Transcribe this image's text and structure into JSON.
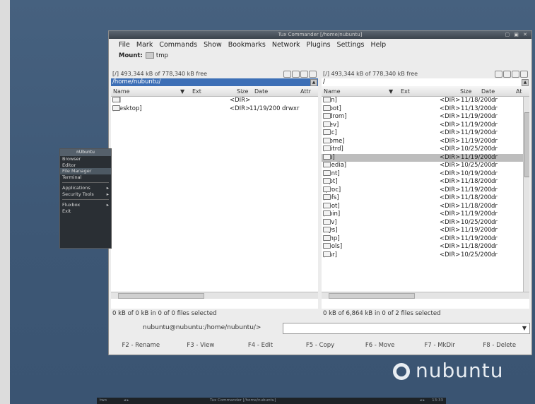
{
  "window": {
    "title": "Tux Commander [/home/nubuntu]",
    "title_buttons": "▢ ▣ ✕"
  },
  "menu": [
    "File",
    "Mark",
    "Commands",
    "Show",
    "Bookmarks",
    "Network",
    "Plugins",
    "Settings",
    "Help"
  ],
  "mount": {
    "label": "Mount:",
    "drive": "tmp"
  },
  "left": {
    "free": "[/] 493,344 kB of 778,340 kB free",
    "path": "/home/nubuntu/",
    "hist": "▲",
    "cols": {
      "name": "Name",
      "ext": "Ext",
      "size": "Size",
      "date": "Date",
      "attr": "Attr"
    },
    "sort_arrow": "▼",
    "rows": [
      {
        "name": "[..]",
        "size": "<DIR>",
        "date": "",
        "attr": "",
        "up": true
      },
      {
        "name": "[Desktop]",
        "size": "<DIR>",
        "date": "11/19/200",
        "attr": "drwxr"
      }
    ],
    "status": "0 kB of 0 kB in 0 of 0 files selected"
  },
  "right": {
    "free": "[/] 493,344 kB of 778,340 kB free",
    "path": "/",
    "hist": "▲",
    "cols": {
      "name": "Name",
      "ext": "Ext",
      "size": "Size",
      "date": "Date",
      "attr": "At"
    },
    "sort_arrow": "▼",
    "rows": [
      {
        "name": "[bin]",
        "size": "<DIR>",
        "date": "11/18/200",
        "attr": "dr"
      },
      {
        "name": "[boot]",
        "size": "<DIR>",
        "date": "11/13/200",
        "attr": "dr"
      },
      {
        "name": "[cdrom]",
        "size": "<DIR>",
        "date": "11/19/200",
        "attr": "dr"
      },
      {
        "name": "[dev]",
        "size": "<DIR>",
        "date": "11/19/200",
        "attr": "dr"
      },
      {
        "name": "[etc]",
        "size": "<DIR>",
        "date": "11/19/200",
        "attr": "dr"
      },
      {
        "name": "[home]",
        "size": "<DIR>",
        "date": "11/19/200",
        "attr": "dr"
      },
      {
        "name": "[initrd]",
        "size": "<DIR>",
        "date": "10/25/200",
        "attr": "dr"
      },
      {
        "name": "[lib]",
        "size": "<DIR>",
        "date": "11/19/200",
        "attr": "dr",
        "sel": true
      },
      {
        "name": "[media]",
        "size": "<DIR>",
        "date": "10/25/200",
        "attr": "dr"
      },
      {
        "name": "[mnt]",
        "size": "<DIR>",
        "date": "10/19/200",
        "attr": "dr"
      },
      {
        "name": "[opt]",
        "size": "<DIR>",
        "date": "11/18/200",
        "attr": "dr"
      },
      {
        "name": "[proc]",
        "size": "<DIR>",
        "date": "11/19/200",
        "attr": "dr"
      },
      {
        "name": "[rofs]",
        "size": "<DIR>",
        "date": "11/18/200",
        "attr": "dr"
      },
      {
        "name": "[root]",
        "size": "<DIR>",
        "date": "11/18/200",
        "attr": "dr"
      },
      {
        "name": "[sbin]",
        "size": "<DIR>",
        "date": "11/19/200",
        "attr": "dr"
      },
      {
        "name": "[srv]",
        "size": "<DIR>",
        "date": "10/25/200",
        "attr": "dr"
      },
      {
        "name": "[sys]",
        "size": "<DIR>",
        "date": "11/19/200",
        "attr": "dr"
      },
      {
        "name": "[tmp]",
        "size": "<DIR>",
        "date": "11/19/200",
        "attr": "dr"
      },
      {
        "name": "[tools]",
        "size": "<DIR>",
        "date": "11/18/200",
        "attr": "dr"
      },
      {
        "name": "[usr]",
        "size": "<DIR>",
        "date": "10/25/200",
        "attr": "dr"
      }
    ],
    "status": "0 kB of 6,864 kB in 0 of 2 files selected"
  },
  "cmd": {
    "prompt": "nubuntu@nubuntu:/home/nubuntu/>",
    "value": "",
    "dropdown": "▼"
  },
  "fkeys": [
    "F2 - Rename",
    "F3 - View",
    "F4 - Edit",
    "F5 - Copy",
    "F6 - Move",
    "F7 - MkDir",
    "F8 - Delete"
  ],
  "kmenu": {
    "header": "nUbuntu",
    "items": [
      {
        "label": "Browser",
        "arrow": ""
      },
      {
        "label": "Editor",
        "arrow": ""
      },
      {
        "label": "File Manager",
        "arrow": ""
      },
      {
        "label": "Terminal",
        "arrow": ""
      },
      {
        "label": "Applications",
        "arrow": "▸",
        "sep_before": true
      },
      {
        "label": "Security Tools",
        "arrow": "▸"
      },
      {
        "label": "Fluxbox",
        "arrow": "▸",
        "sep_before": true
      },
      {
        "label": "Exit",
        "arrow": ""
      }
    ],
    "selected_index": 2
  },
  "logo": "nubuntu",
  "taskbar": {
    "ws": "two",
    "arrows": "◂ ▸",
    "title": "Tux Commander [/home/nubuntu]",
    "nav": "◂ ▸",
    "clock": "13:33"
  }
}
